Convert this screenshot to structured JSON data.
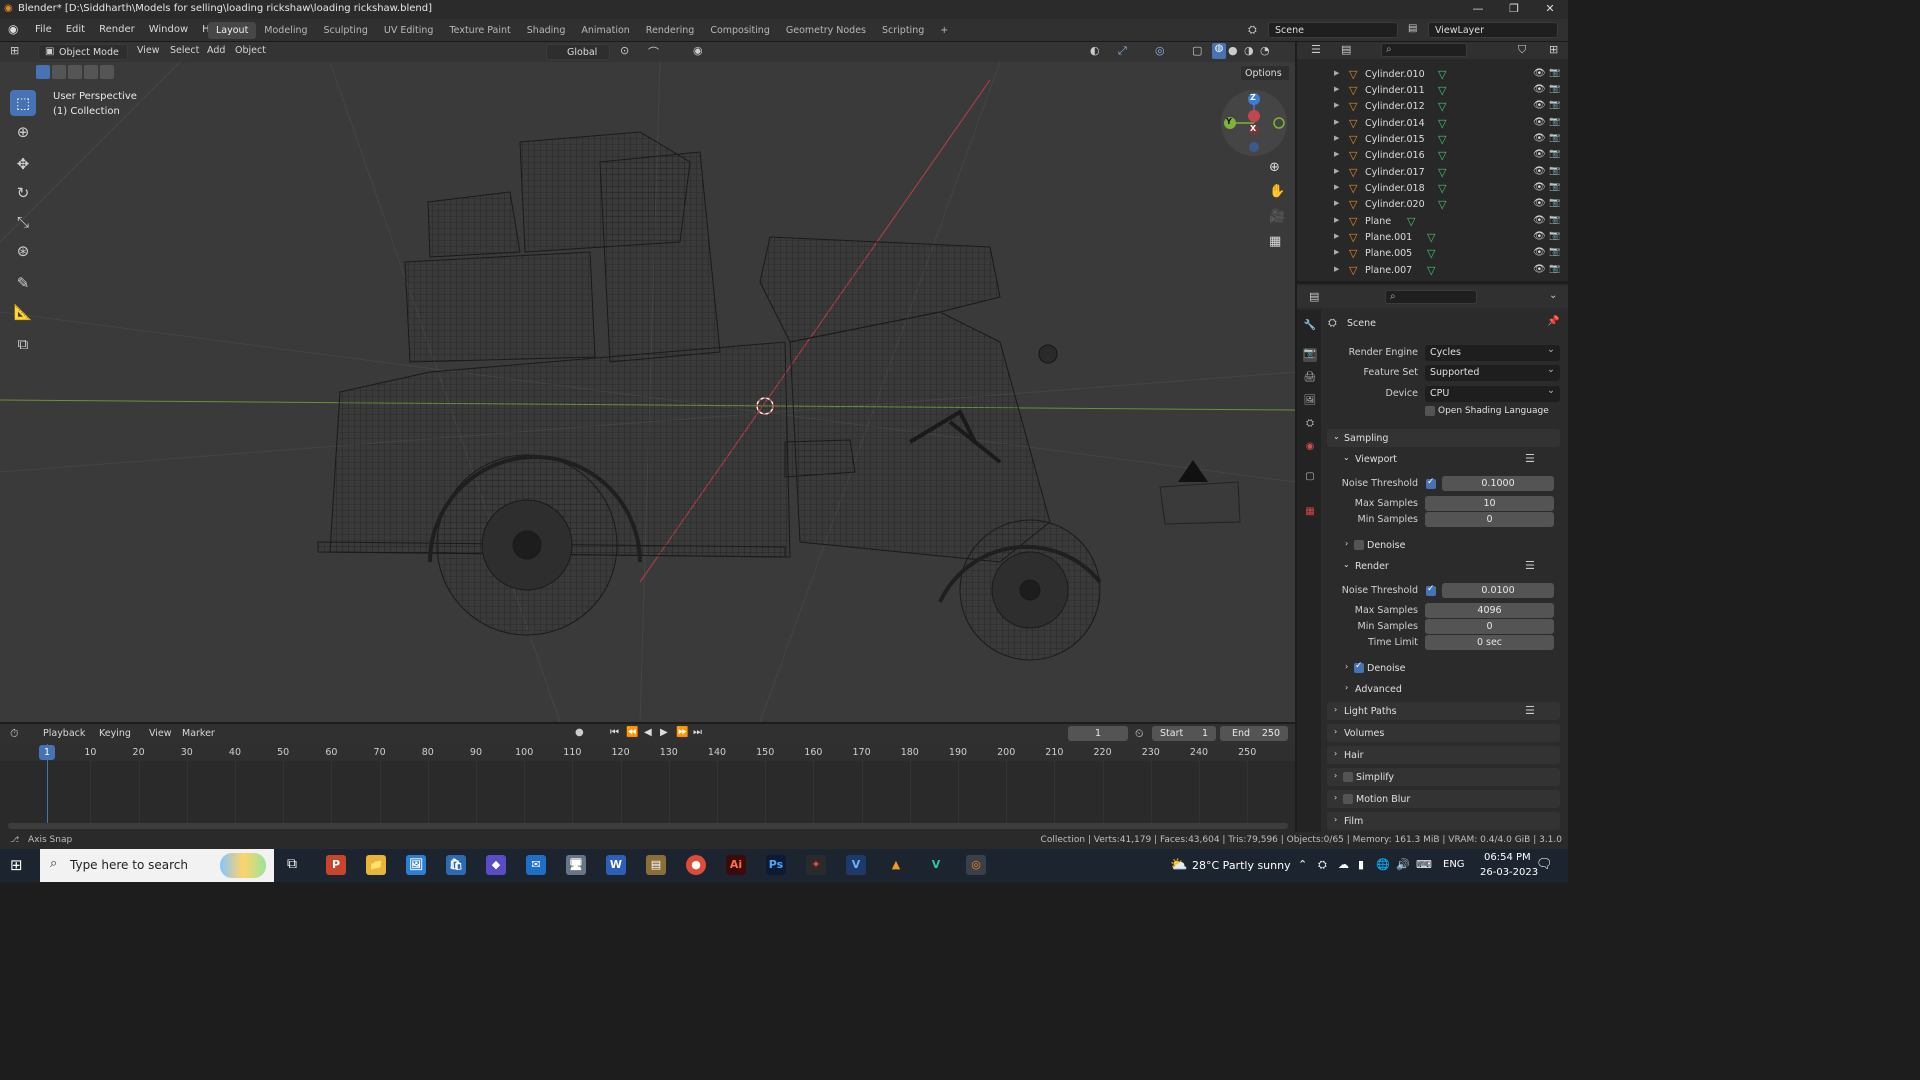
{
  "window": {
    "title": "Blender* [D:\\Siddharth\\Models for selling\\loading rickshaw\\loading rickshaw.blend]",
    "controls": [
      "—",
      "❐",
      "✕"
    ]
  },
  "menu": [
    "File",
    "Edit",
    "Render",
    "Window",
    "Help"
  ],
  "workspaces": [
    "Layout",
    "Modeling",
    "Sculpting",
    "UV Editing",
    "Texture Paint",
    "Shading",
    "Animation",
    "Rendering",
    "Compositing",
    "Geometry Nodes",
    "Scripting",
    "+"
  ],
  "active_workspace": "Layout",
  "scene": {
    "name": "Scene",
    "view_layer": "ViewLayer"
  },
  "viewport": {
    "mode": "Object Mode",
    "menus": [
      "View",
      "Select",
      "Add",
      "Object"
    ],
    "transform_orientation": "Global",
    "options_label": "Options",
    "info_line1": "User Perspective",
    "info_line2": "(1) Collection",
    "gizmo": {
      "z": "Z",
      "y": "Y",
      "x": "X"
    }
  },
  "tools": [
    "select-box",
    "cursor",
    "move",
    "rotate",
    "scale",
    "transform",
    "annotate",
    "measure",
    "add-cube"
  ],
  "outliner": {
    "items": [
      {
        "name": "Cylinder.010"
      },
      {
        "name": "Cylinder.011"
      },
      {
        "name": "Cylinder.012"
      },
      {
        "name": "Cylinder.014"
      },
      {
        "name": "Cylinder.015"
      },
      {
        "name": "Cylinder.016"
      },
      {
        "name": "Cylinder.017"
      },
      {
        "name": "Cylinder.018"
      },
      {
        "name": "Cylinder.020"
      },
      {
        "name": "Plane"
      },
      {
        "name": "Plane.001"
      },
      {
        "name": "Plane.005"
      },
      {
        "name": "Plane.007"
      }
    ]
  },
  "properties": {
    "context": "Scene",
    "render_engine_label": "Render Engine",
    "render_engine": "Cycles",
    "feature_set_label": "Feature Set",
    "feature_set": "Supported",
    "device_label": "Device",
    "device": "CPU",
    "osl_label": "Open Shading Language",
    "sampling": "Sampling",
    "viewport": "Viewport",
    "noise_threshold_label": "Noise Threshold",
    "vp_noise_threshold": "0.1000",
    "max_samples_label": "Max Samples",
    "vp_max_samples": "10",
    "min_samples_label": "Min Samples",
    "vp_min_samples": "0",
    "denoise_label": "Denoise",
    "render": "Render",
    "r_noise_threshold": "0.0100",
    "r_max_samples": "4096",
    "r_min_samples": "0",
    "time_limit_label": "Time Limit",
    "r_time_limit": "0 sec",
    "advanced": "Advanced",
    "sections": [
      "Light Paths",
      "Volumes",
      "Hair",
      "Simplify",
      "Motion Blur",
      "Film"
    ]
  },
  "timeline": {
    "menus": [
      "Playback",
      "Keying",
      "View",
      "Marker"
    ],
    "current_frame": "1",
    "start_label": "Start",
    "start": "1",
    "end_label": "End",
    "end": "250",
    "ticks": [
      "1",
      "10",
      "20",
      "30",
      "40",
      "50",
      "60",
      "70",
      "80",
      "90",
      "100",
      "110",
      "120",
      "130",
      "140",
      "150",
      "160",
      "170",
      "180",
      "190",
      "200",
      "210",
      "220",
      "230",
      "240",
      "250"
    ]
  },
  "status": {
    "left": "Axis Snap",
    "right": "Collection | Verts:41,179 | Faces:43,604 | Tris:79,596 | Objects:0/65 | Memory: 161.3 MiB | VRAM: 0.4/4.0 GiB | 3.1.0"
  },
  "taskbar": {
    "search_placeholder": "Type here to search",
    "weather": "28°C  Partly sunny",
    "lang": "ENG",
    "time": "06:54 PM",
    "date": "26-03-2023",
    "apps": [
      "P",
      "📁",
      "🖼",
      "🛍",
      "◆",
      "✉",
      "🖥",
      "W",
      "▤",
      "●",
      "Ai",
      "Ps",
      "✦",
      "V",
      "▲",
      "V",
      "◎"
    ]
  },
  "colors": {
    "accent": "#4772b3",
    "object_icon": "#e38a2c",
    "mesh_icon": "#4fc26e",
    "axis_x": "#c0474c",
    "axis_y": "#7fb337",
    "axis_z": "#3f7ad3"
  }
}
